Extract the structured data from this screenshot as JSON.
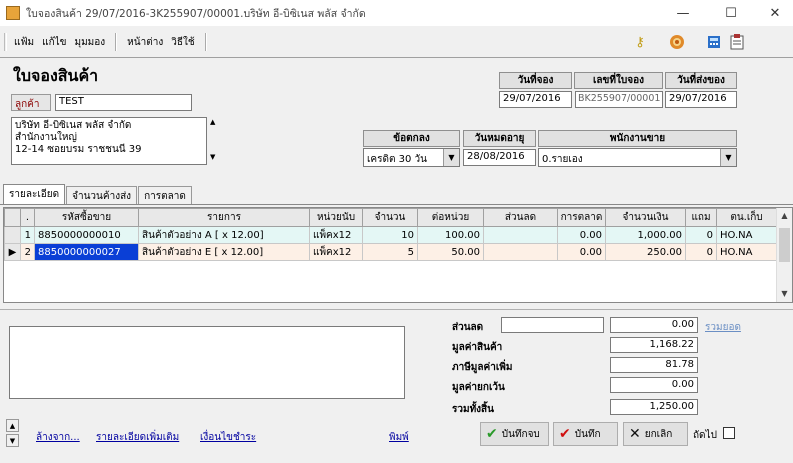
{
  "window": {
    "title": "ใบจองสินค้า 29/07/2016-3K255907/00001.บริษัท อี-บิซิเนส พลัส จำกัด",
    "minimize": "—",
    "maximize": "☐",
    "close": "✕"
  },
  "menu": {
    "file": "แฟ้ม",
    "edit": "แก้ไข",
    "view": "มุมมอง",
    "window": "หน้าต่าง",
    "help": "วิธีใช้"
  },
  "toolbar": {
    "icons": [
      "key-icon",
      "target-icon",
      "calculator-icon",
      "clipboard-icon"
    ]
  },
  "form": {
    "title": "ใบจองสินค้า",
    "customer_label": "ลูกค้า",
    "customer_value": "TEST",
    "address_lines": [
      "บริษัท อี-บิซิเนส พลัส จำกัด",
      "สำนักงานใหญ่",
      "12-14 ซอยบรม ราชชนนี 39"
    ],
    "booking_date_label": "วันที่จอง",
    "booking_date": "29/07/2016",
    "doc_no_label": "เลขที่ใบจอง",
    "doc_no": "BK255907/00001",
    "ship_date_label": "วันที่ส่งของ",
    "ship_date": "29/07/2016",
    "terms_label": "ข้อตกลง",
    "terms_value": "เครดิต 30 วัน",
    "expire_label": "วันหมดอายุ",
    "expire_date": "28/08/2016",
    "sales_label": "พนักงานขาย",
    "sales_value": "0.รายเอง"
  },
  "tabs": [
    {
      "label": "รายละเอียด",
      "active": true
    },
    {
      "label": "จำนวนค้างส่ง",
      "active": false
    },
    {
      "label": "การตลาด",
      "active": false
    }
  ],
  "grid": {
    "columns": [
      ".",
      "รหัสซื้อขาย",
      "รายการ",
      "หน่วยนับ",
      "จำนวน",
      "ต่อหน่วย",
      "ส่วนลด",
      "การตลาด",
      "จำนวนเงิน",
      "แถม",
      "ตน.เก็บ"
    ],
    "rows": [
      {
        "indicator": "",
        "no": "1",
        "code": "8850000000010",
        "desc": "สินค้าตัวอย่าง A [ x 12.00]",
        "unit": "แพ็คx12",
        "qty": "10",
        "price": "100.00",
        "disc": "",
        "mkt": "0.00",
        "amount": "1,000.00",
        "free": "0",
        "loc": "HO.NA"
      },
      {
        "indicator": "▶",
        "no": "2",
        "code": "8850000000027",
        "desc": "สินค้าตัวอย่าง E [ x 12.00]",
        "unit": "แพ็คx12",
        "qty": "5",
        "price": "50.00",
        "disc": "",
        "mkt": "0.00",
        "amount": "250.00",
        "free": "0",
        "loc": "HO.NA"
      }
    ]
  },
  "summary": {
    "discount_label": "ส่วนลด",
    "discount_input": "",
    "discount_value": "0.00",
    "total_discount_link": "รวมยอด",
    "goods_label": "มูลค่าสินค้า",
    "goods_value": "1,168.22",
    "vat_label": "ภาษีมูลค่าเพิ่ม",
    "vat_value": "81.78",
    "exempt_label": "มูลค่ายกเว้น",
    "exempt_value": "0.00",
    "total_label": "รวมทั้งสิ้น",
    "total_value": "1,250.00"
  },
  "footer": {
    "link_prev": "ล้างจาก...",
    "link_more": "รายละเอียดเพิ่มเติม",
    "link_terms": "เงื่อนไขชำระ",
    "link_print": "พิมพ์",
    "btn_save_print": "บันทึกจบ",
    "btn_save": "บันทึก",
    "btn_cancel": "ยกเลิก",
    "next_label": "ถัดไป"
  }
}
